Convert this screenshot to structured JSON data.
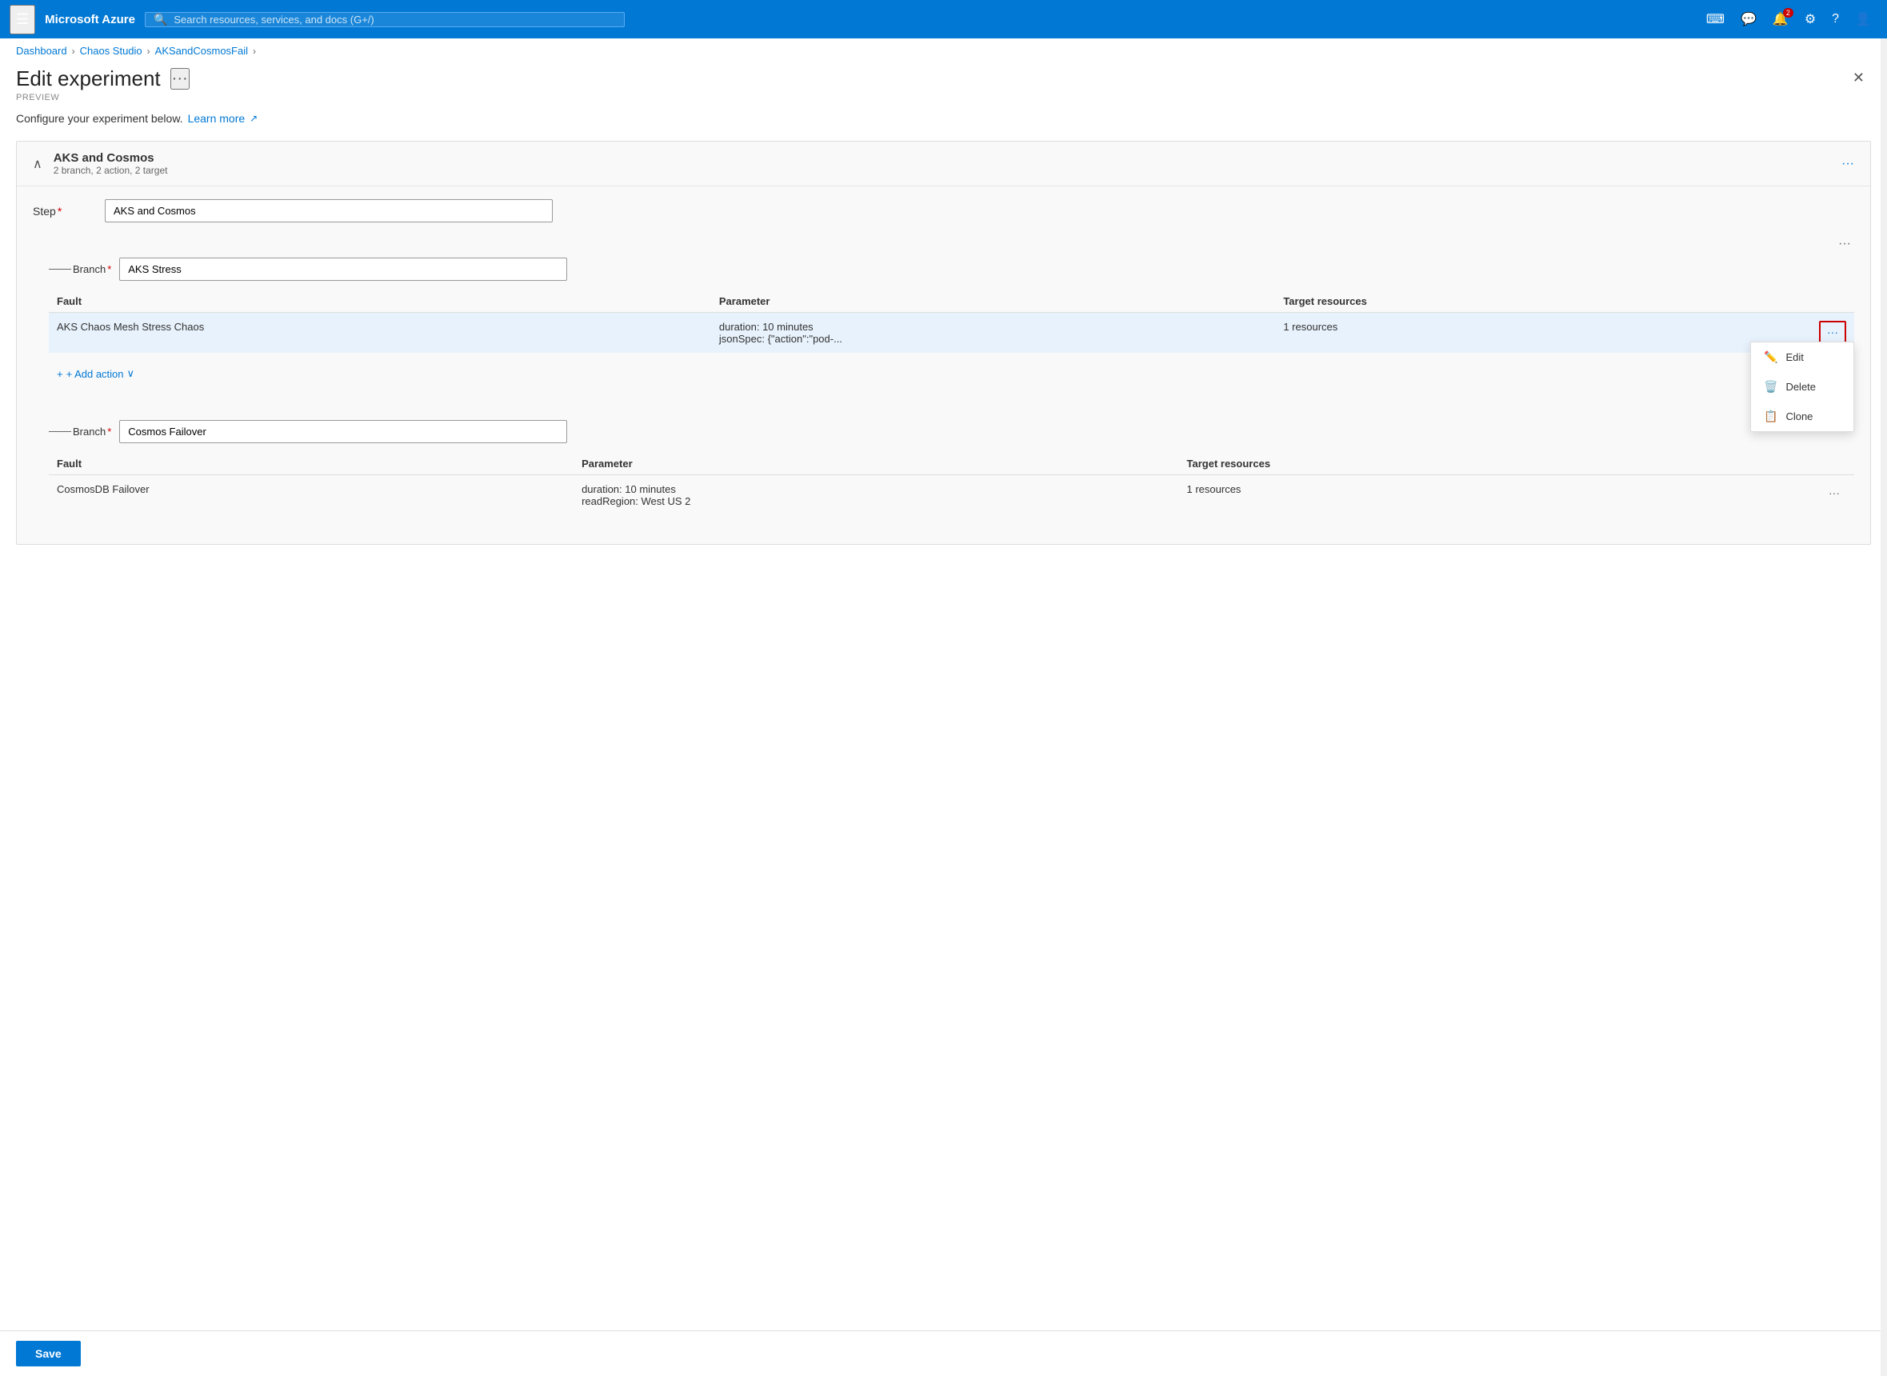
{
  "topnav": {
    "brand": "Microsoft Azure",
    "search_placeholder": "Search resources, services, and docs (G+/)",
    "notification_count": "2"
  },
  "breadcrumb": {
    "items": [
      "Dashboard",
      "Chaos Studio",
      "AKSandCosmosFail"
    ],
    "separators": [
      ">",
      ">",
      ">"
    ]
  },
  "page": {
    "title": "Edit experiment",
    "ellipsis_label": "···",
    "subtitle": "PREVIEW",
    "configure_text": "Configure your experiment below.",
    "learn_more": "Learn more",
    "close_label": "✕"
  },
  "step": {
    "name": "AKS and Cosmos",
    "meta": "2 branch, 2 action, 2 target",
    "name_input_value": "AKS and Cosmos",
    "step_label": "Step",
    "ellipsis_label": "···"
  },
  "branch1": {
    "label": "Branch",
    "name_input_value": "AKS Stress",
    "ellipsis_label": "···",
    "fault_col": "Fault",
    "param_col": "Parameter",
    "target_col": "Target resources",
    "faults": [
      {
        "name": "AKS Chaos Mesh Stress Chaos",
        "params": "duration: 10 minutes\njsonSpec: {\"action\":\"pod-...",
        "targets": "1 resources"
      }
    ],
    "add_action_label": "+ Add action",
    "add_action_chevron": "∨"
  },
  "context_menu": {
    "items": [
      {
        "icon": "edit",
        "label": "Edit"
      },
      {
        "icon": "delete",
        "label": "Delete"
      },
      {
        "icon": "clone",
        "label": "Clone"
      }
    ]
  },
  "branch2": {
    "label": "Branch",
    "name_input_value": "Cosmos Failover",
    "ellipsis_label": "···",
    "fault_col": "Fault",
    "param_col": "Parameter",
    "target_col": "Target resources",
    "faults": [
      {
        "name": "CosmosDB Failover",
        "params": "duration: 10 minutes\nreadRegion: West US 2",
        "targets": "1 resources"
      }
    ]
  },
  "save_button": "Save"
}
